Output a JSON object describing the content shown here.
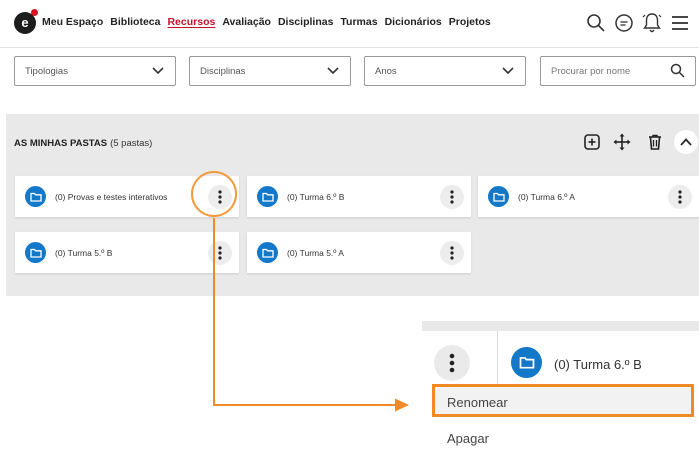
{
  "brand": {
    "logo_letter": "e"
  },
  "nav": {
    "items": [
      {
        "label": "Meu Espaço",
        "active": false
      },
      {
        "label": "Biblioteca",
        "active": false
      },
      {
        "label": "Recursos",
        "active": true
      },
      {
        "label": "Avaliação",
        "active": false
      },
      {
        "label": "Disciplinas",
        "active": false
      },
      {
        "label": "Turmas",
        "active": false
      },
      {
        "label": "Dicionários",
        "active": false
      },
      {
        "label": "Projetos",
        "active": false
      }
    ],
    "icons": [
      "search-icon",
      "chat-icon",
      "bell-icon",
      "hamburger-menu-icon"
    ]
  },
  "filters": {
    "tipologias": "Tipologias",
    "disciplinas": "Disciplinas",
    "anos": "Anos",
    "search_placeholder": "Procurar por nome"
  },
  "folders_panel": {
    "title": "AS MINHAS PASTAS",
    "count": "(5 pastas)",
    "actions": [
      "add-icon",
      "move-icon",
      "trash-icon",
      "chevron-up-icon"
    ],
    "folders": [
      {
        "label": "(0) Provas e testes interativos"
      },
      {
        "label": "(0) Turma 6.º B"
      },
      {
        "label": "(0) Turma 6.º A"
      },
      {
        "label": "(0) Turma 5.º B"
      },
      {
        "label": "(0) Turma 5.º A"
      }
    ]
  },
  "zoom_view": {
    "folder_label": "(0) Turma 6.º B",
    "menu": [
      {
        "label": "Renomear",
        "highlighted": true
      },
      {
        "label": "Apagar",
        "highlighted": false
      }
    ]
  },
  "colors": {
    "accent": "#c8102e",
    "folder_blue": "#1478c8",
    "highlight_orange": "#f08a24"
  }
}
